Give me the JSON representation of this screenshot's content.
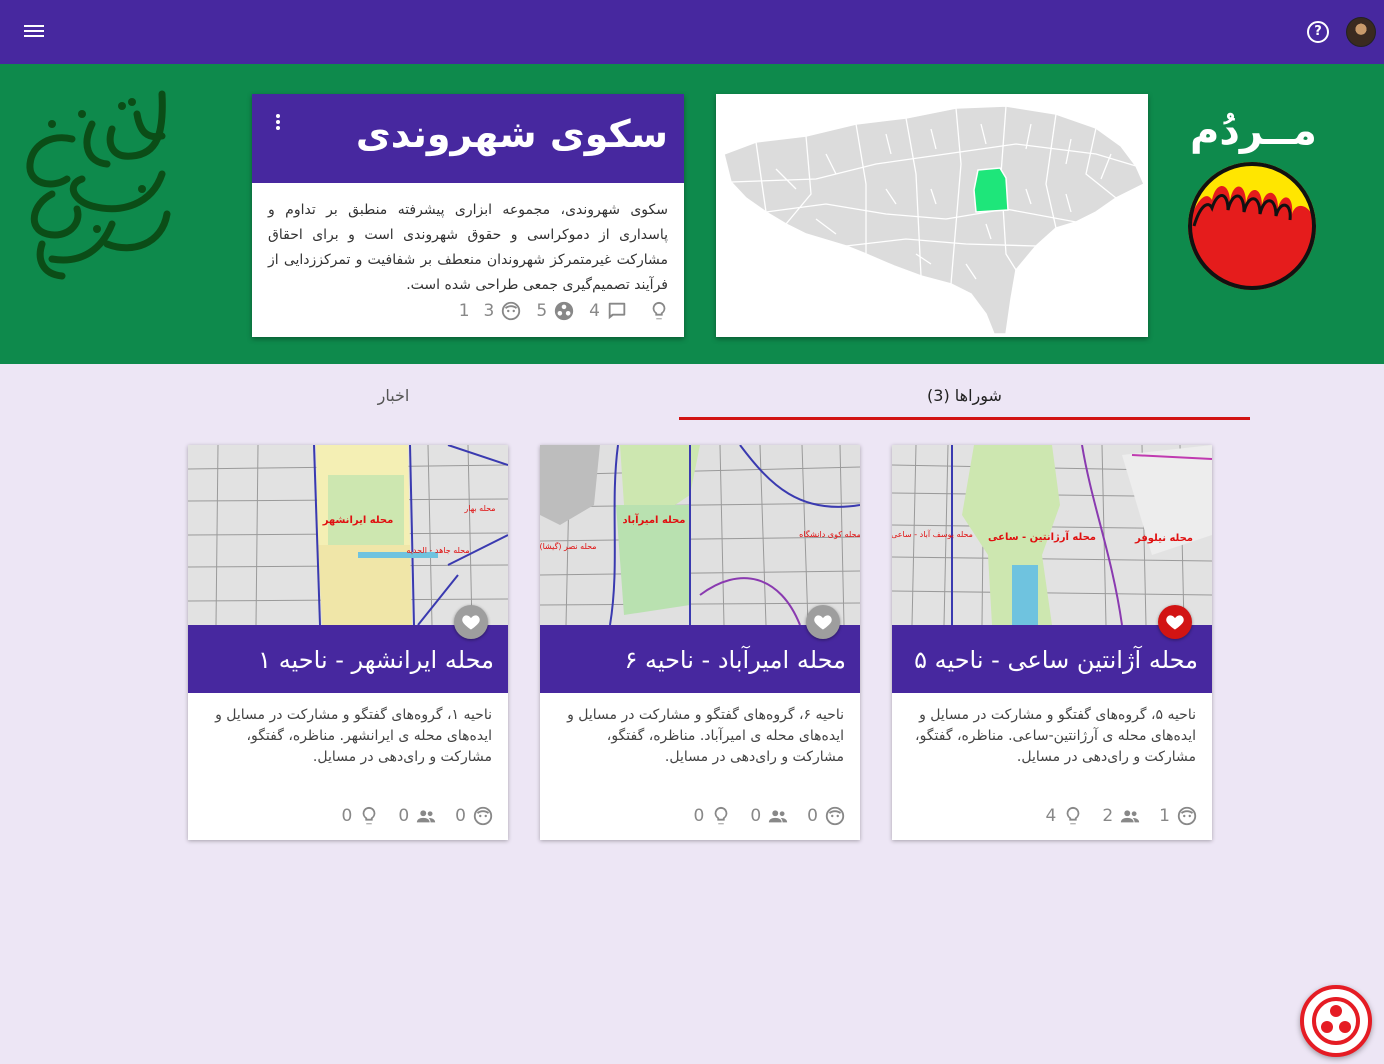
{
  "header": {
    "menu_icon": "hamburger-menu-icon",
    "help_icon": "help-circle-icon",
    "help_glyph": "?",
    "colors": {
      "bar": "#47289f"
    }
  },
  "banner": {
    "color": "#0e8a4c",
    "platform_title": "سکوی شهروندی",
    "platform_description": "سکوی شهروندی، مجموعه ابزاری پیشرفته منطبق بر تداوم و پاسداری از دموکراسی و حقوق شهروندی است و برای احقاق مشارکت غیرمتمرکز شهروندان منعطف بر شفافیت و تمرکززدایی از فرآیند تصمیم‌گیری جمعی طراحی شده است.",
    "stats": [
      {
        "icon": "lightbulb-icon",
        "value": ""
      },
      {
        "icon": "comment-icon",
        "value": "4"
      },
      {
        "icon": "groups-icon",
        "value": "5"
      },
      {
        "icon": "face-icon",
        "value": "3"
      },
      {
        "icon": "",
        "value": "1"
      }
    ],
    "brand_name": "مــردُم"
  },
  "tabs": [
    {
      "label": "شوراها  (3)",
      "active": true
    },
    {
      "label": "اخبار",
      "active": false
    }
  ],
  "cards": [
    {
      "title": "محله آژانتین ساعی - ناحیه ۵",
      "description": "ناحیه ۵، گروه‌های گفتگو و مشارکت در مسایل و ایده‌های محله ی آرژانتین-ساعی. مناظره، گفتگو، مشارکت و رای‌دهی در مسایل.",
      "favorited": true,
      "stats": {
        "faces": "1",
        "members": "2",
        "ideas": "4"
      },
      "map_labels": [
        "محله آرژانتین - ساعی",
        "محله یوسف آباد - ساعی",
        "محله نیلوفر"
      ]
    },
    {
      "title": "محله امیرآباد - ناحیه ۶",
      "description": "ناحیه ۶، گروه‌های گفتگو و مشارکت در مسایل و ایده‌های محله ی امیرآباد. مناظره، گفتگو، مشارکت و رای‌دهی در مسایل.",
      "favorited": false,
      "stats": {
        "faces": "0",
        "members": "0",
        "ideas": "0"
      },
      "map_labels": [
        "محله امیرآباد",
        "محله نصر (گیشا)",
        "محله کوی دانشگاه"
      ]
    },
    {
      "title": "محله ایرانشهر - ناحیه ۱",
      "description": "ناحیه ۱، گروه‌های گفتگو و مشارکت در مسایل و ایده‌های محله ی ایرانشهر. مناظره، گفتگو، مشارکت و رای‌دهی در مسایل.",
      "favorited": false,
      "stats": {
        "faces": "0",
        "members": "0",
        "ideas": "0"
      },
      "map_labels": [
        "محله ایرانشهر",
        "محله بهار",
        "محله جاهد - الحدیه"
      ]
    }
  ],
  "fab": {
    "icon": "people-dots-icon"
  }
}
